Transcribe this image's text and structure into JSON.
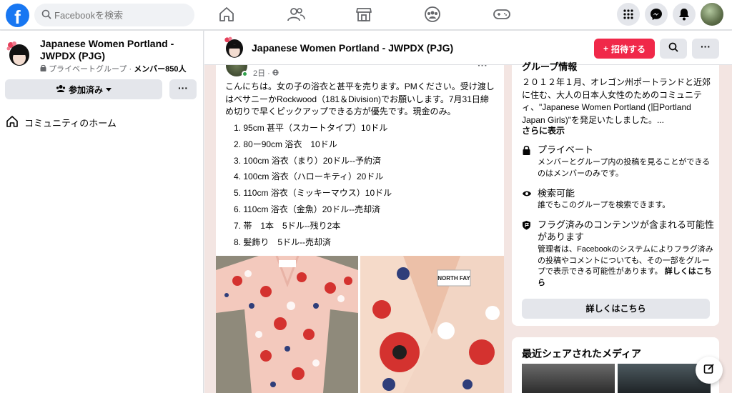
{
  "topbar": {
    "logo_letter": "f",
    "search_placeholder": "Facebookを検索",
    "nav_icons": [
      "home-icon",
      "friends-icon",
      "marketplace-icon",
      "groups-icon",
      "gaming-icon"
    ],
    "right_icons": [
      "menu-grid-icon",
      "messenger-icon",
      "notifications-icon"
    ]
  },
  "sidebar": {
    "group_name": "Japanese Women Portland - JWPDX (PJG)",
    "privacy_label": "プライベートグループ",
    "separator": " · ",
    "members_label": "メンバー850人",
    "joined_button": "参加済み",
    "more_button": "···",
    "nav_items": [
      {
        "label": "コミュニティのホーム",
        "icon": "home-icon"
      }
    ]
  },
  "group_header": {
    "title": "Japanese Women Portland - JWPDX (PJG)",
    "invite_button": "招待する",
    "invite_prefix": "+",
    "more_button": "···"
  },
  "post": {
    "time": "2日 · ",
    "more": "···",
    "text": "こんにちは。女の子の浴衣と甚平を売ります。PMください。受け渡しはベサニーかRockwood（181＆Division)でお願いします。7月31日締め切りで早くピックアップできる方が優先です。現金のみ。",
    "items": [
      "1. 95cm 甚平（スカートタイプ）10ドル",
      "2. 80ー90cm 浴衣　10ドル",
      "3. 100cm 浴衣（まり）20ドル--予約済",
      "4. 100cm 浴衣（ハローキティ）20ドル",
      "5. 110cm 浴衣（ミッキーマウス）10ドル",
      "6. 110cm 浴衣（金魚）20ドル--売却済",
      "7. 帯　1本　5ドル--残り2本",
      "8. 髪飾り　5ドル--売却済"
    ],
    "photo2_label": "NORTH FAY"
  },
  "about": {
    "title_cut": "グループ情報",
    "description": "２０１２年１月、オレゴン州ポートランドと近郊に住む、大人の日本人女性のためのコミュニティ、\"Japanese Women Portland (旧Portland Japan Girls)\"を発足いたしました。...",
    "show_more": "さらに表示",
    "items": [
      {
        "icon": "lock-icon",
        "title": "プライベート",
        "desc": "メンバーとグループ内の投稿を見ることができるのはメンバーのみです。"
      },
      {
        "icon": "eye-icon",
        "title": "検索可能",
        "desc": "誰でもこのグループを検索できます。"
      },
      {
        "icon": "flag-shield-icon",
        "title": "フラグ済みのコンテンツが含まれる可能性があります",
        "desc": "管理者は、Facebookのシステムによりフラグ済みの投稿やコメントについても、その一部をグループで表示できる可能性があります。 ",
        "desc_link": "詳しくはこちら"
      }
    ],
    "learn_button": "詳しくはこちら"
  },
  "media": {
    "title": "最近シェアされたメディア"
  },
  "colors": {
    "brand": "#1877f2",
    "invite": "#f02849",
    "bg": "#f0f2f5"
  }
}
